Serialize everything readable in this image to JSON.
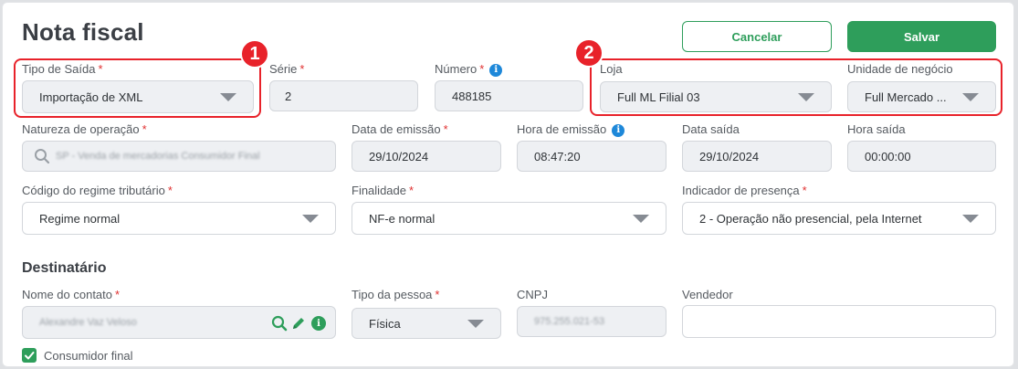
{
  "page": {
    "title": "Nota fiscal"
  },
  "actions": {
    "cancel_label": "Cancelar",
    "save_label": "Salvar"
  },
  "annotations": {
    "badge1": "1",
    "badge2": "2"
  },
  "fields": {
    "tipo_saida": {
      "label": "Tipo de Saída",
      "required": "*",
      "value": "Importação de XML"
    },
    "serie": {
      "label": "Série",
      "required": "*",
      "value": "2"
    },
    "numero": {
      "label": "Número",
      "required": "*",
      "value": "488185"
    },
    "loja": {
      "label": "Loja",
      "value": "Full ML Filial 03"
    },
    "unidade_negocio": {
      "label": "Unidade de negócio",
      "value": "Full Mercado ..."
    },
    "natureza_operacao": {
      "label": "Natureza de operação",
      "required": "*",
      "placeholder": "SP - Venda de mercadorias Consumidor Final"
    },
    "data_emissao": {
      "label": "Data de emissão",
      "required": "*",
      "value": "29/10/2024"
    },
    "hora_emissao": {
      "label": "Hora de emissão",
      "value": "08:47:20"
    },
    "data_saida": {
      "label": "Data saída",
      "value": "29/10/2024"
    },
    "hora_saida": {
      "label": "Hora saída",
      "value": "00:00:00"
    },
    "regime_tributario": {
      "label": "Código do regime tributário",
      "required": "*",
      "value": "Regime normal"
    },
    "finalidade": {
      "label": "Finalidade",
      "required": "*",
      "value": "NF-e normal"
    },
    "indicador_presenca": {
      "label": "Indicador de presença",
      "required": "*",
      "value": "2 - Operação não presencial, pela Internet"
    }
  },
  "destinatario": {
    "section_title": "Destinatário",
    "nome_contato": {
      "label": "Nome do contato",
      "required": "*",
      "value": "Alexandre Vaz Veloso"
    },
    "tipo_pessoa": {
      "label": "Tipo da pessoa",
      "required": "*",
      "value": "Física"
    },
    "cnpj": {
      "label": "CNPJ",
      "value": "975.255.021-53"
    },
    "vendedor": {
      "label": "Vendedor",
      "value": ""
    },
    "consumidor_final": {
      "label": "Consumidor final",
      "checked": "true"
    }
  },
  "icons": {
    "info": "info-icon",
    "search": "search-icon",
    "edit": "pencil-icon",
    "check": "checkmark-icon",
    "dropdown": "chevron-down-icon"
  },
  "colors": {
    "accent": "#2e9e5b",
    "highlight": "#e8222a",
    "info": "#1e88d9"
  }
}
